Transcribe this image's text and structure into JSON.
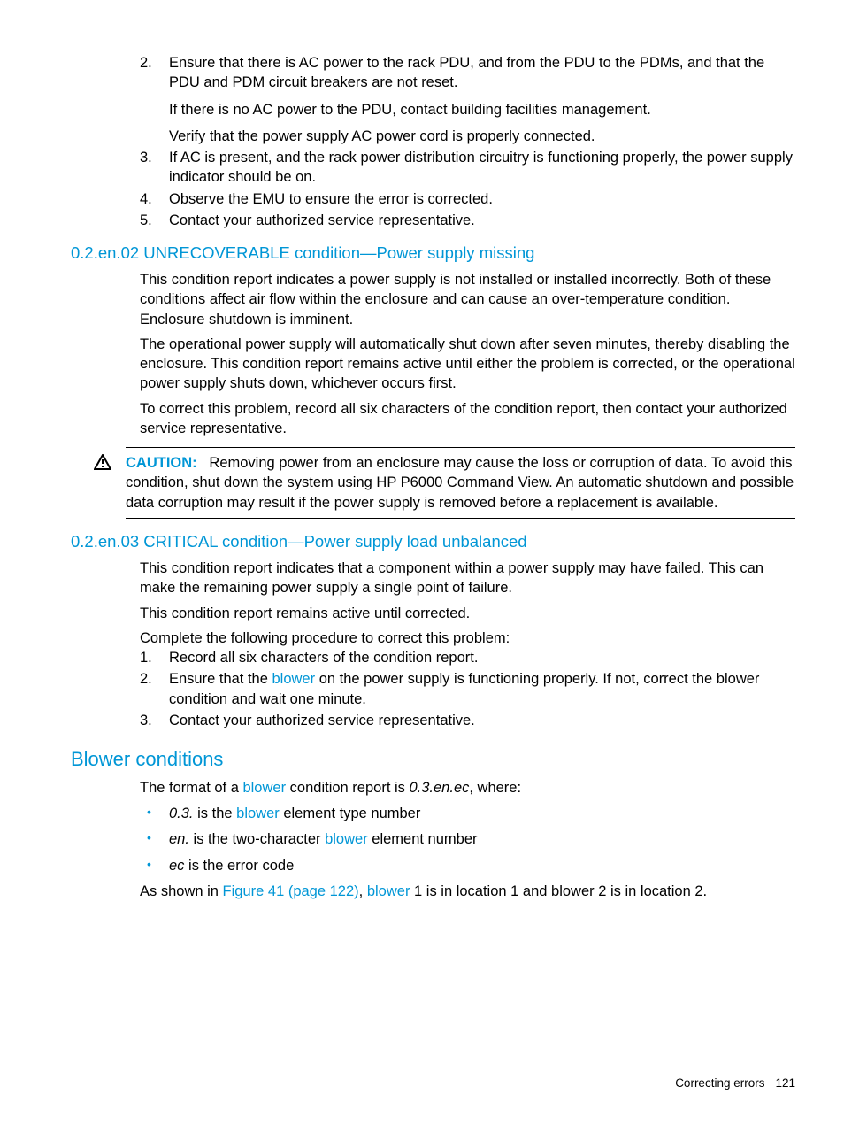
{
  "top_ol": {
    "start": 2,
    "items": [
      {
        "num": "2.",
        "text": "Ensure that there is AC power to the rack PDU, and from the PDU to the PDMs, and that the PDU and PDM circuit breakers are not reset.",
        "subs": [
          "If there is no AC power to the PDU, contact building facilities management.",
          "Verify that the power supply AC power cord is properly connected."
        ]
      },
      {
        "num": "3.",
        "text": "If AC is present, and the rack power distribution circuitry is functioning properly, the power supply indicator should be on."
      },
      {
        "num": "4.",
        "text": "Observe the EMU to ensure the error is corrected."
      },
      {
        "num": "5.",
        "text": "Contact your authorized service representative."
      }
    ]
  },
  "sec02": {
    "heading": "0.2.en.02 UNRECOVERABLE condition—Power supply missing",
    "p1": "This condition report indicates a power supply is not installed or installed incorrectly. Both of these conditions affect air flow within the enclosure and can cause an over-temperature condition. Enclosure shutdown is imminent.",
    "p2": "The operational power supply will automatically shut down after seven minutes, thereby disabling the enclosure. This condition report remains active until either the problem is corrected, or the operational power supply shuts down, whichever occurs first.",
    "p3": "To correct this problem, record all six characters of the condition report, then contact your authorized service representative.",
    "caution_label": "CAUTION:",
    "caution_text": "Removing power from an enclosure may cause the loss or corruption of data. To avoid this condition, shut down the system using HP P6000 Command View. An automatic shutdown and possible data corruption may result if the power supply is removed before a replacement is available."
  },
  "sec03": {
    "heading": "0.2.en.03 CRITICAL condition—Power supply load unbalanced",
    "p1": "This condition report indicates that a component within a power supply may have failed. This can make the remaining power supply a single point of failure.",
    "p2": "This condition report remains active until corrected.",
    "p3": "Complete the following procedure to correct this problem:",
    "ol": [
      {
        "num": "1.",
        "text": "Record all six characters of the condition report."
      },
      {
        "num": "2.",
        "pre": "Ensure that the ",
        "link": "blower",
        "post": " on the power supply is functioning properly. If not, correct the blower condition and wait one minute."
      },
      {
        "num": "3.",
        "text": "Contact your authorized service representative."
      }
    ]
  },
  "blower": {
    "heading": "Blower conditions",
    "p1_pre": "The format of a ",
    "p1_link": "blower",
    "p1_mid": " condition report is ",
    "p1_em": "0.3.en.ec",
    "p1_post": ", where:",
    "ul": [
      {
        "em": "0.3.",
        "mid": " is the ",
        "link": "blower",
        "post": " element type number"
      },
      {
        "em": "en.",
        "mid": " is the two-character ",
        "link": "blower",
        "post": " element number"
      },
      {
        "em": "ec",
        "post": " is the error code"
      }
    ],
    "p2_pre": "As shown in ",
    "p2_link1": "Figure 41 (page 122)",
    "p2_sep": ", ",
    "p2_link2": "blower",
    "p2_post": " 1 is in location 1 and blower 2 is in location 2."
  },
  "footer": {
    "section": "Correcting errors",
    "page": "121"
  }
}
